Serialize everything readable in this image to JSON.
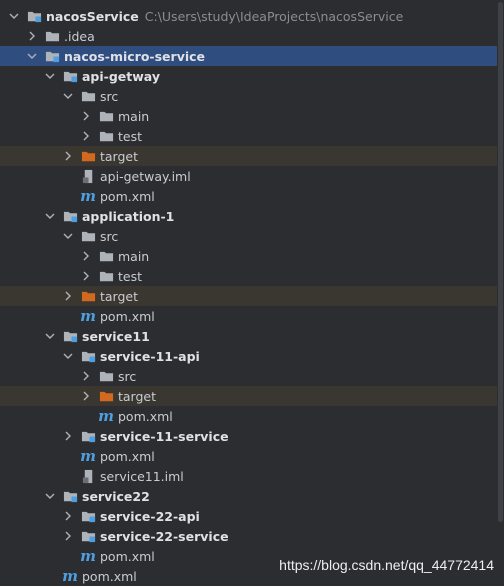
{
  "tree": {
    "root": {
      "label": "nacosService",
      "path": "C:\\Users\\study\\IdeaProjects\\nacosService"
    },
    "idea": {
      "label": ".idea"
    },
    "micro": {
      "label": "nacos-micro-service"
    },
    "api_getway": {
      "label": "api-getway",
      "src": "src",
      "main": "main",
      "test": "test",
      "target": "target",
      "iml": "api-getway.iml",
      "pom": "pom.xml"
    },
    "application1": {
      "label": "application-1",
      "src": "src",
      "main": "main",
      "test": "test",
      "target": "target",
      "pom": "pom.xml"
    },
    "service11": {
      "label": "service11",
      "api": {
        "label": "service-11-api",
        "src": "src",
        "target": "target",
        "pom": "pom.xml"
      },
      "service": {
        "label": "service-11-service"
      },
      "pom": "pom.xml",
      "iml": "service11.iml"
    },
    "service22": {
      "label": "service22",
      "api": {
        "label": "service-22-api"
      },
      "service": {
        "label": "service-22-service"
      },
      "pom": "pom.xml"
    },
    "root_pom": "pom.xml"
  },
  "watermark": "https://blog.csdn.net/qq_44772414",
  "colors": {
    "background": "#2b2d30",
    "selection": "#2f4d7f",
    "excluded_row": "#3a3731",
    "folder": "#aeb3ba",
    "target_folder": "#d2691e",
    "maven_blue": "#4f9fe0"
  }
}
